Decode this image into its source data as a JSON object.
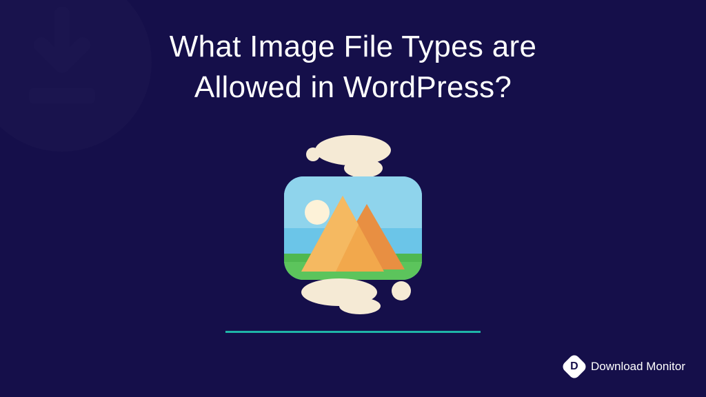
{
  "title_line1": "What Image File Types are",
  "title_line2": "Allowed in WordPress?",
  "badge": {
    "letter": "D",
    "label": "Download Monitor"
  },
  "illustration": {
    "name": "landscape-image-icon",
    "colors": {
      "frame_cream": "#f5ead5",
      "sky": "#6bc5e8",
      "sun": "#fdf2d8",
      "grass": "#5cc45c",
      "mountain_front": "#f2a84c",
      "mountain_back": "#e88f42",
      "underline": "#1fb5a8"
    }
  }
}
